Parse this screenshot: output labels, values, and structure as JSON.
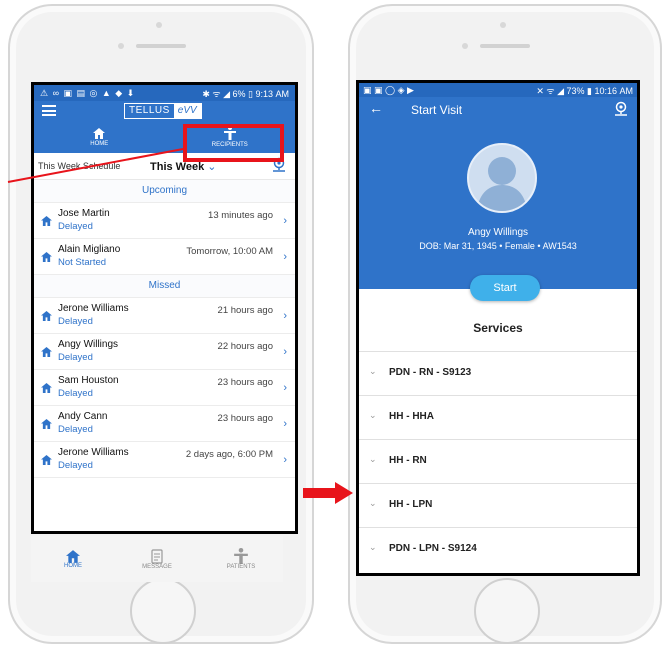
{
  "left_screen": {
    "status_bar": {
      "left_icons": "⚠ ∞ ▣ ▤ ◎ ▲ ◆ ⬇",
      "right": "✱ ᯤ ◢ 6% ▯ 9:13 AM"
    },
    "logo": {
      "part1": "TELLUS",
      "part2": "eVV"
    },
    "nav_tabs": [
      {
        "label": "HOME",
        "icon": "home-icon"
      },
      {
        "label": "RECIPIENTS",
        "icon": "person-icon"
      }
    ],
    "schedule_label": "This Week Schedule",
    "schedule_filter": "This Week",
    "sections": [
      {
        "header": "Upcoming",
        "rows": [
          {
            "name": "Jose Martin",
            "status": "Delayed",
            "time": "13 minutes ago"
          },
          {
            "name": "Alain  Migliano",
            "status": "Not Started",
            "time": "Tomorrow, 10:00 AM"
          }
        ]
      },
      {
        "header": "Missed",
        "rows": [
          {
            "name": "Jerone Williams",
            "status": "Delayed",
            "time": "21 hours ago"
          },
          {
            "name": "Angy Willings",
            "status": "Delayed",
            "time": "22 hours ago"
          },
          {
            "name": "Sam Houston",
            "status": "Delayed",
            "time": "23 hours ago"
          },
          {
            "name": "Andy Cann",
            "status": "Delayed",
            "time": "23 hours ago"
          },
          {
            "name": "Jerone Williams",
            "status": "Delayed",
            "time": "2 days ago, 6:00 PM"
          }
        ]
      }
    ],
    "bottom_nav": [
      {
        "label": "HOME",
        "icon": "home-icon"
      },
      {
        "label": "MESSAGE",
        "icon": "message-icon"
      },
      {
        "label": "PATIENTS",
        "icon": "person-icon"
      }
    ]
  },
  "right_screen": {
    "status_bar": {
      "left_icons": "▣ ▣ ◯ ◈ ▶",
      "right": "✕ ᯤ ◢ 73% ▮ 10:16 AM"
    },
    "title": "Start Visit",
    "patient_name": "Angy Willings",
    "patient_details": "DOB: Mar 31, 1945 • Female • AW1543",
    "start_button": "Start",
    "services_header": "Services",
    "services": [
      "PDN - RN - S9123",
      "HH - HHA",
      "HH - RN",
      "HH - LPN",
      "PDN - LPN - S9124"
    ]
  },
  "colors": {
    "primary": "#2f73c9",
    "highlight": "#e8141b",
    "button": "#3fb0ea"
  }
}
